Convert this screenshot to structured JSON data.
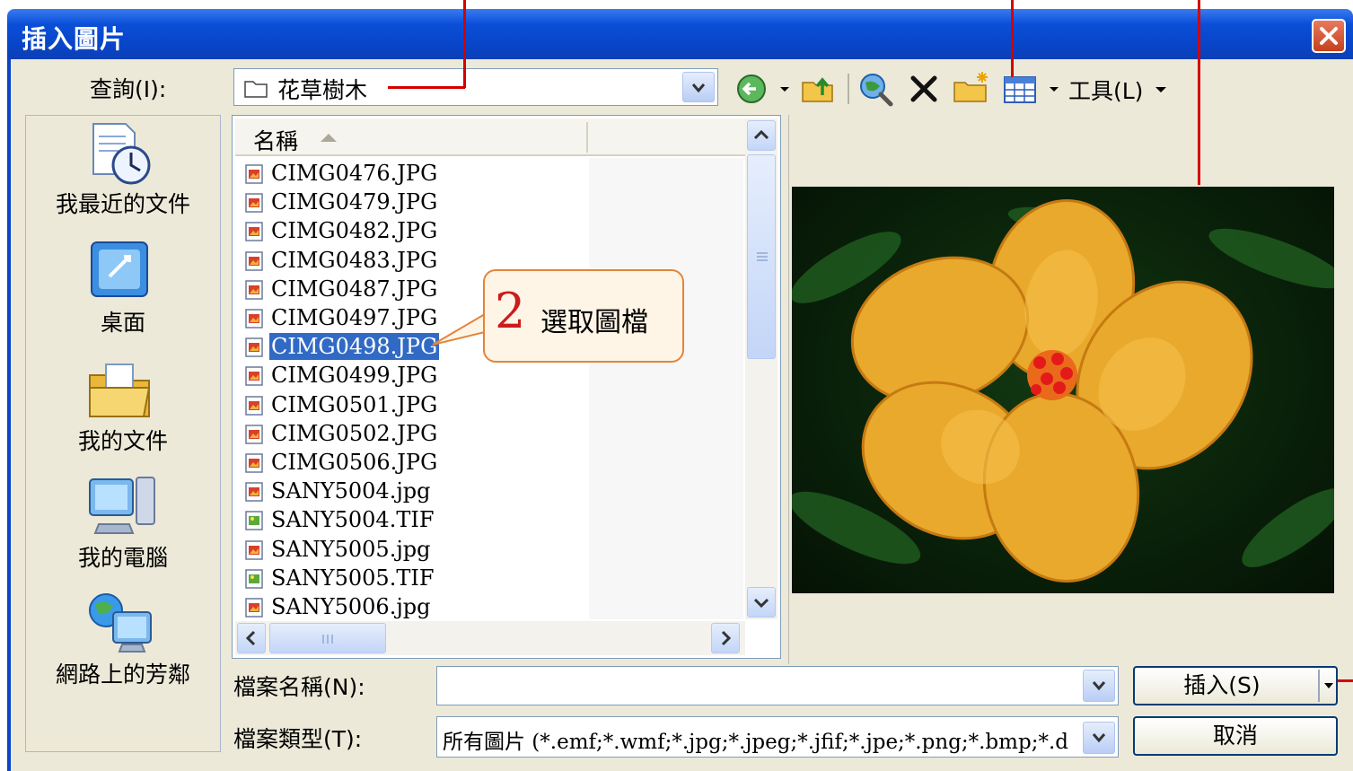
{
  "window": {
    "title": "插入圖片"
  },
  "toolbar": {
    "lookin_label": "查詢(I):",
    "lookin_value": "花草樹木",
    "tools_label": "工具(L)"
  },
  "places": [
    {
      "label": "我最近的文件",
      "icon": "recent-documents-icon"
    },
    {
      "label": "桌面",
      "icon": "desktop-icon"
    },
    {
      "label": "我的文件",
      "icon": "my-documents-icon"
    },
    {
      "label": "我的電腦",
      "icon": "my-computer-icon"
    },
    {
      "label": "網路上的芳鄰",
      "icon": "network-places-icon"
    }
  ],
  "filelist": {
    "column_name": "名稱",
    "files": [
      {
        "name": "CIMG0476.JPG",
        "type": "jpg"
      },
      {
        "name": "CIMG0479.JPG",
        "type": "jpg"
      },
      {
        "name": "CIMG0482.JPG",
        "type": "jpg"
      },
      {
        "name": "CIMG0483.JPG",
        "type": "jpg"
      },
      {
        "name": "CIMG0487.JPG",
        "type": "jpg"
      },
      {
        "name": "CIMG0497.JPG",
        "type": "jpg"
      },
      {
        "name": "CIMG0498.JPG",
        "type": "jpg",
        "selected": true
      },
      {
        "name": "CIMG0499.JPG",
        "type": "jpg"
      },
      {
        "name": "CIMG0501.JPG",
        "type": "jpg"
      },
      {
        "name": "CIMG0502.JPG",
        "type": "jpg"
      },
      {
        "name": "CIMG0506.JPG",
        "type": "jpg"
      },
      {
        "name": "SANY5004.jpg",
        "type": "jpg"
      },
      {
        "name": "SANY5004.TIF",
        "type": "tif"
      },
      {
        "name": "SANY5005.jpg",
        "type": "jpg"
      },
      {
        "name": "SANY5005.TIF",
        "type": "tif"
      },
      {
        "name": "SANY5006.jpg",
        "type": "jpg"
      }
    ]
  },
  "callout": {
    "number": "2",
    "text": "選取圖檔"
  },
  "bottom": {
    "filename_label": "檔案名稱(N):",
    "filename_value": "",
    "filetype_label": "檔案類型(T):",
    "filetype_value": "所有圖片 (*.emf;*.wmf;*.jpg;*.jpeg;*.jfif;*.jpe;*.png;*.bmp;*.d",
    "insert_button": "插入(S)",
    "cancel_button": "取消"
  },
  "colors": {
    "titlebar": "#0a4fd8",
    "selection": "#316ac5",
    "annotation": "#d40000",
    "callout_border": "#e3843a"
  }
}
